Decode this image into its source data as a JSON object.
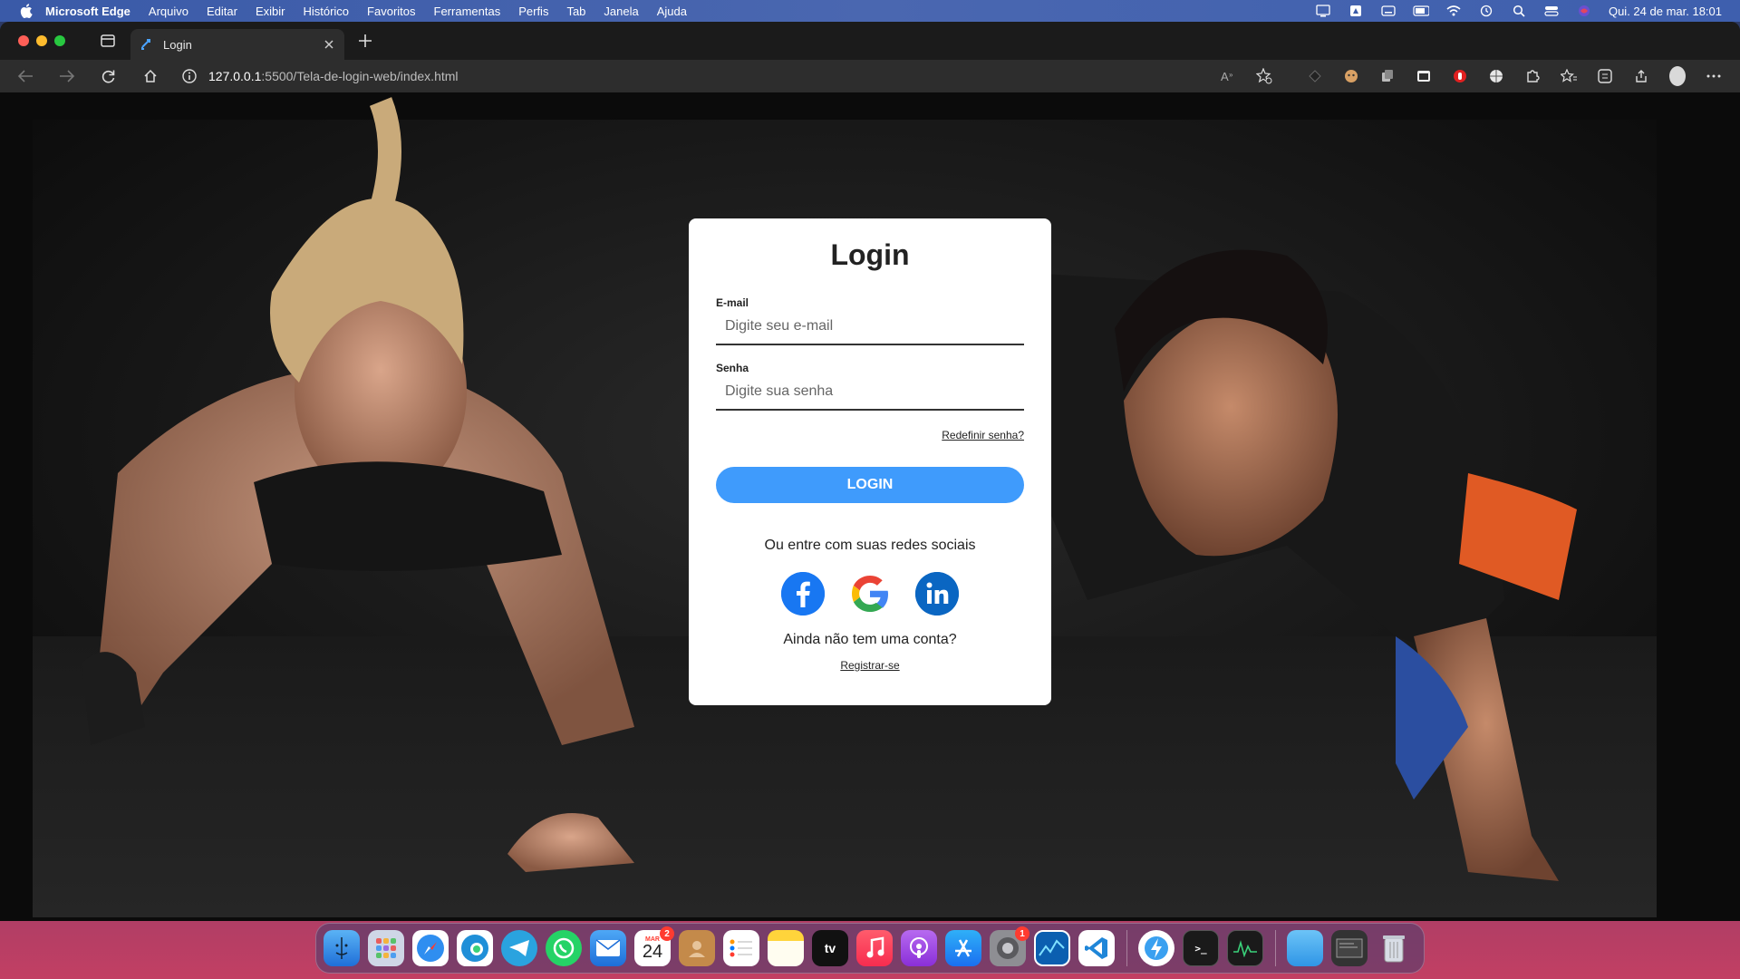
{
  "menubar": {
    "app_name": "Microsoft Edge",
    "items": [
      "Arquivo",
      "Editar",
      "Exibir",
      "Histórico",
      "Favoritos",
      "Ferramentas",
      "Perfis",
      "Tab",
      "Janela",
      "Ajuda"
    ],
    "clock": "Qui. 24 de mar.  18:01"
  },
  "browser": {
    "tab_title": "Login",
    "address_host": "127.0.0.1",
    "address_rest": ":5500/Tela-de-login-web/index.html"
  },
  "login": {
    "title": "Login",
    "email_label": "E-mail",
    "email_placeholder": "Digite seu e-mail",
    "password_label": "Senha",
    "password_placeholder": "Digite sua senha",
    "forgot_link": "Redefinir senha?",
    "login_button": "LOGIN",
    "social_text": "Ou entre com suas redes sociais",
    "social": [
      "facebook-icon",
      "google-icon",
      "linkedin-icon"
    ],
    "signup_question": "Ainda não tem uma conta?",
    "register_link": "Registrar-se",
    "button_color": "#3f9bfc"
  },
  "dock": {
    "calendar_month": "MAR",
    "calendar_day": "24",
    "calendar_badge": "2",
    "settings_badge": "1",
    "appletv_label": "tv"
  }
}
